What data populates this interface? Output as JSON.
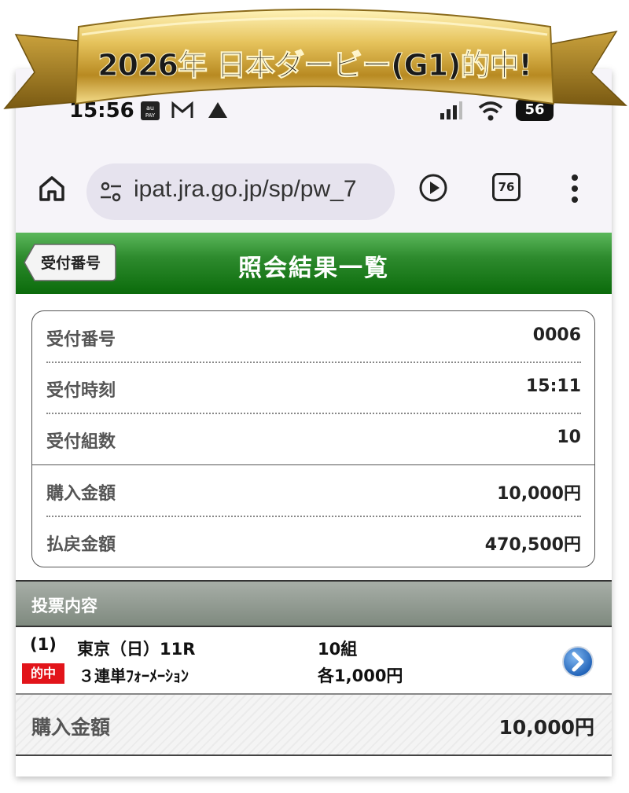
{
  "banner": {
    "text": "2026年 日本ダービー(G1)的中!"
  },
  "status_bar": {
    "time": "15:56",
    "battery": "56"
  },
  "browser": {
    "url": "ipat.jra.go.jp/sp/pw_7",
    "tab_count": "76"
  },
  "header": {
    "back_label": "受付番号",
    "title": "照会結果一覧"
  },
  "summary": {
    "rows": [
      {
        "label": "受付番号",
        "value": "0006"
      },
      {
        "label": "受付時刻",
        "value": "15:11"
      },
      {
        "label": "受付組数",
        "value": "10"
      },
      {
        "label": "購入金額",
        "value": "10,000円"
      },
      {
        "label": "払戻金額",
        "value": "470,500円"
      }
    ]
  },
  "section": {
    "title": "投票内容"
  },
  "bet": {
    "number": "(1)",
    "race": "東京（日）11R",
    "count": "10組",
    "badge": "的中",
    "type": "３連単ﾌｫｰﾒｰｼｮﾝ",
    "unit": "各1,000円"
  },
  "total": {
    "label": "購入金額",
    "value": "10,000円"
  },
  "colors": {
    "header_green": "#117a11",
    "hit_red": "#e2141a",
    "section_gray": "#8c968c",
    "link_blue": "#2a73c9",
    "banner_gold": "#d9b54a"
  }
}
